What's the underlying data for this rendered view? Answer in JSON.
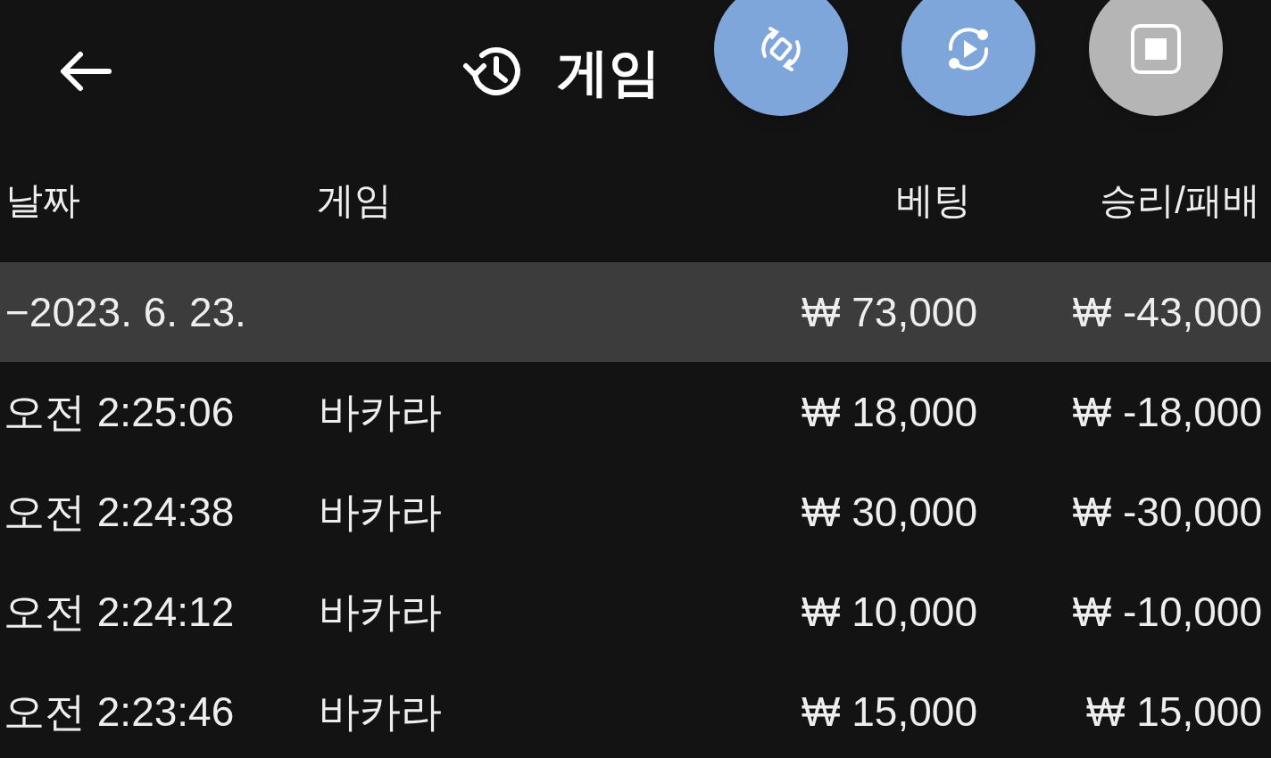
{
  "header": {
    "title": "게임"
  },
  "floating_buttons": [
    {
      "kind": "rotate",
      "color": "#7fa6da"
    },
    {
      "kind": "replay",
      "color": "#7fa6da"
    },
    {
      "kind": "stop",
      "color": "#b5b5b5"
    }
  ],
  "table": {
    "columns": [
      "날짜",
      "게임",
      "베팅",
      "승리/패배"
    ],
    "groups": [
      {
        "label": "−2023. 6. 23.",
        "bet": "₩ 73,000",
        "result": "₩ -43,000",
        "expanded": true,
        "rows": [
          {
            "time": "오전 2:25:06",
            "game": "바카라",
            "bet": "₩ 18,000",
            "result": "₩ -18,000"
          },
          {
            "time": "오전 2:24:38",
            "game": "바카라",
            "bet": "₩ 30,000",
            "result": "₩ -30,000"
          },
          {
            "time": "오전 2:24:12",
            "game": "바카라",
            "bet": "₩ 10,000",
            "result": "₩ -10,000"
          },
          {
            "time": "오전 2:23:46",
            "game": "바카라",
            "bet": "₩ 15,000",
            "result": "₩ 15,000"
          }
        ]
      }
    ]
  }
}
